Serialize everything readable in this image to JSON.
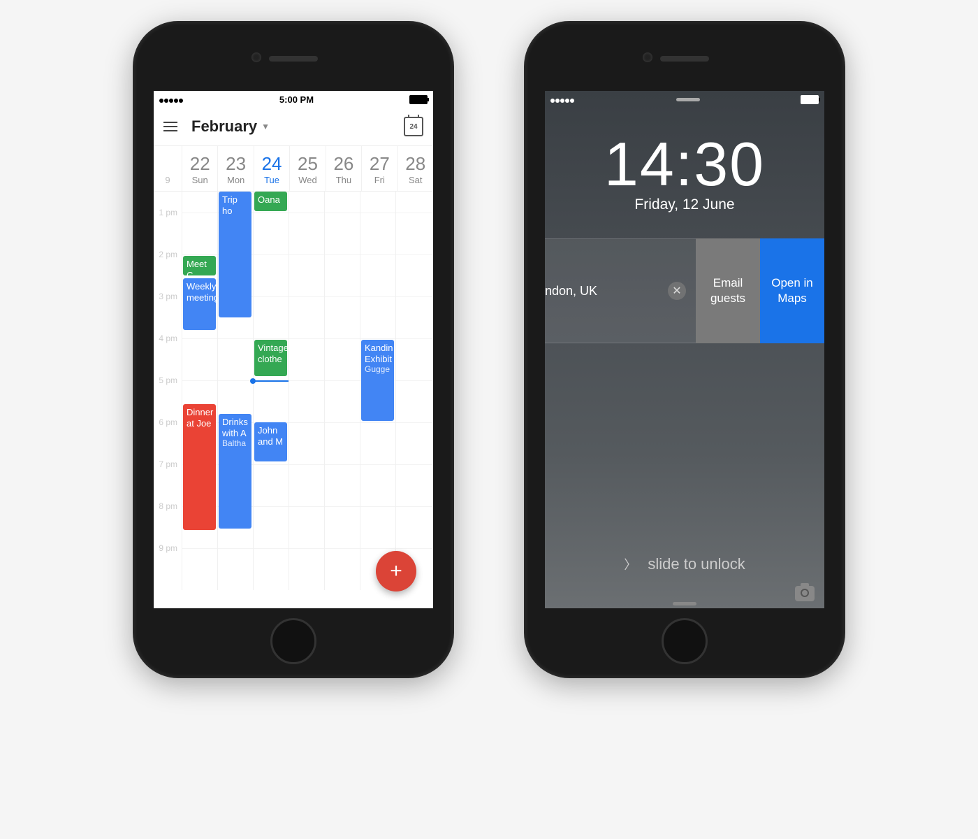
{
  "phone1": {
    "statusbar": {
      "time": "5:00 PM"
    },
    "header": {
      "month": "February",
      "today_badge": "24"
    },
    "week_label": "9",
    "days": [
      {
        "num": "22",
        "name": "Sun",
        "today": false
      },
      {
        "num": "23",
        "name": "Mon",
        "today": false
      },
      {
        "num": "24",
        "name": "Tue",
        "today": true
      },
      {
        "num": "25",
        "name": "Wed",
        "today": false
      },
      {
        "num": "26",
        "name": "Thu",
        "today": false
      },
      {
        "num": "27",
        "name": "Fri",
        "today": false
      },
      {
        "num": "28",
        "name": "Sat",
        "today": false
      }
    ],
    "hours": [
      "1 pm",
      "2 pm",
      "3 pm",
      "4 pm",
      "5 pm",
      "6 pm",
      "7 pm",
      "8 pm",
      "9 pm"
    ],
    "events": {
      "meet": {
        "title": "Meet C",
        "color": "#34a853"
      },
      "weekly": {
        "title": "Weekly meeting",
        "color": "#4285f4"
      },
      "dinner": {
        "title": "Dinner at Joe",
        "color": "#ea4335"
      },
      "trip": {
        "title": "Trip ho",
        "color": "#4285f4"
      },
      "drinks": {
        "title": "Drinks with A",
        "sub": "Baltha",
        "color": "#4285f4"
      },
      "oana": {
        "title": "Oana",
        "color": "#34a853"
      },
      "vintage": {
        "title": "Vintage clothe",
        "color": "#34a853"
      },
      "john": {
        "title": "John and M",
        "color": "#4285f4"
      },
      "kandin": {
        "title": "Kandin Exhibit",
        "sub": "Gugge",
        "color": "#4285f4"
      }
    },
    "fab": "+"
  },
  "phone2": {
    "time": "14:30",
    "date": "Friday, 12 June",
    "notification": {
      "location": "ndon, UK",
      "action_email": "Email guests",
      "action_maps": "Open in Maps"
    },
    "slide": "slide to unlock"
  }
}
